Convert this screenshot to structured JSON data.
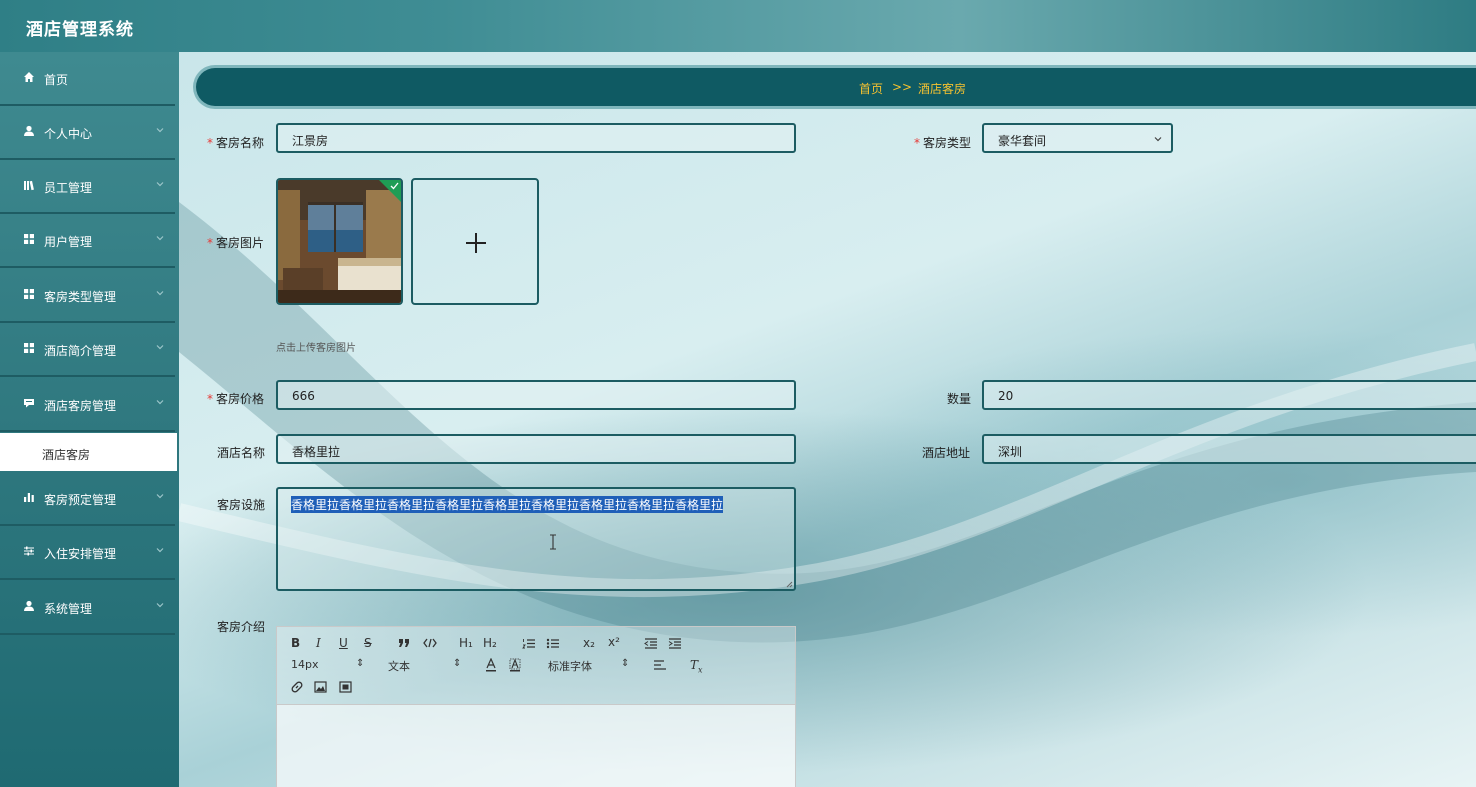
{
  "app": {
    "title": "酒店管理系统"
  },
  "sidebar": {
    "items": [
      {
        "label": "首页",
        "icon": "home-icon"
      },
      {
        "label": "个人中心",
        "icon": "user-icon"
      },
      {
        "label": "员工管理",
        "icon": "library-icon"
      },
      {
        "label": "用户管理",
        "icon": "grid-icon"
      },
      {
        "label": "客房类型管理",
        "icon": "grid-icon"
      },
      {
        "label": "酒店简介管理",
        "icon": "grid-icon"
      },
      {
        "label": "酒店客房管理",
        "icon": "comment-icon"
      },
      {
        "label": "客房预定管理",
        "icon": "bar-chart-icon"
      },
      {
        "label": "入住安排管理",
        "icon": "sliders-icon"
      },
      {
        "label": "系统管理",
        "icon": "user-icon"
      }
    ],
    "active_sub": "酒店客房"
  },
  "breadcrumb": {
    "home": "首页",
    "sep": ">>",
    "current": "酒店客房"
  },
  "form": {
    "room_name": {
      "label": "客房名称",
      "value": "江景房"
    },
    "room_type": {
      "label": "客房类型",
      "value": "豪华套间"
    },
    "room_image": {
      "label": "客房图片",
      "hint": "点击上传客房图片"
    },
    "room_price": {
      "label": "客房价格",
      "value": "666"
    },
    "quantity": {
      "label": "数量",
      "value": "20"
    },
    "hotel_name": {
      "label": "酒店名称",
      "value": "香格里拉"
    },
    "hotel_address": {
      "label": "酒店地址",
      "value": "深圳"
    },
    "facilities": {
      "label": "客房设施",
      "value": "香格里拉香格里拉香格里拉香格里拉香格里拉香格里拉香格里拉香格里拉香格里拉"
    },
    "intro": {
      "label": "客房介绍"
    }
  },
  "editor": {
    "font_size": "14px",
    "format": "文本",
    "font_family": "标准字体",
    "bold": "B",
    "italic": "I",
    "underline": "U",
    "strike": "S",
    "h1": "H₁",
    "h2": "H₂",
    "sub": "x₂",
    "sup": "x²"
  },
  "colors": {
    "accent": "#0f5a63",
    "breadcrumb_text": "#f5c230",
    "required": "#e53935",
    "selection": "#1f5fb8"
  }
}
